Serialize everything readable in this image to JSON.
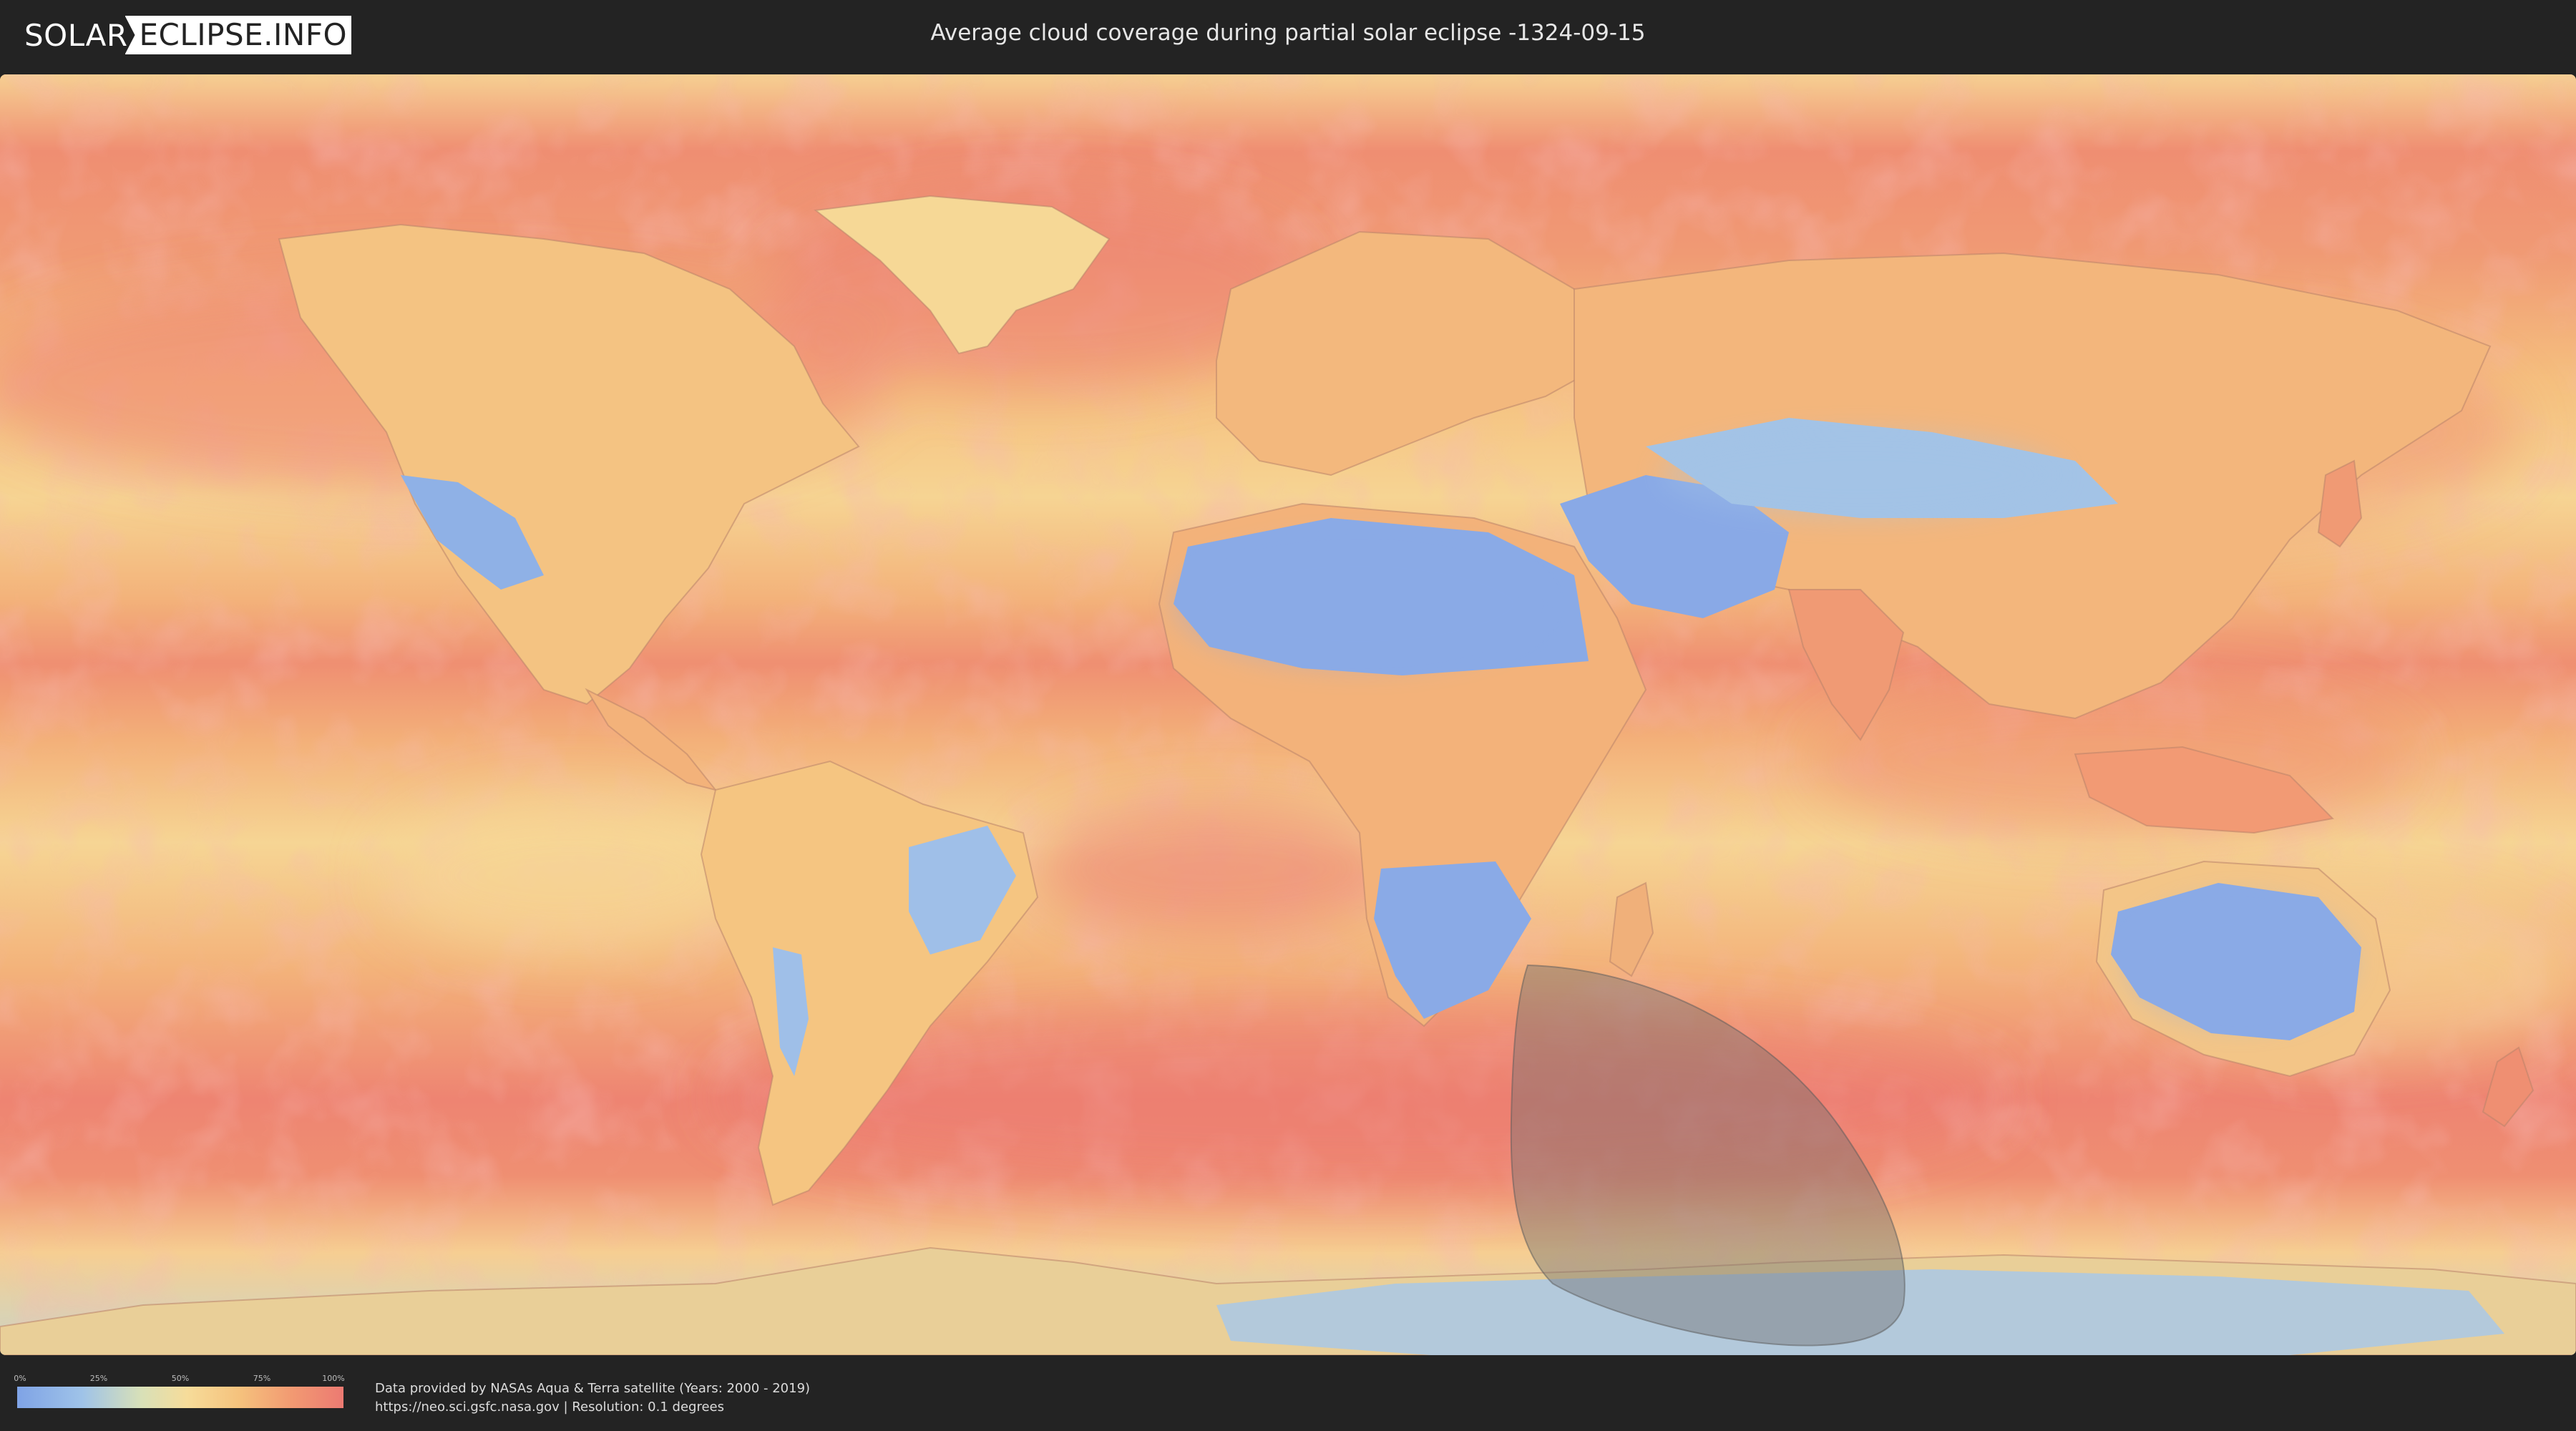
{
  "header": {
    "logo_left": "SOLAR",
    "logo_right": "ECLIPSE.INFO",
    "title": "Average cloud coverage during partial solar eclipse -1324-09-15"
  },
  "legend": {
    "ticks": [
      "0%",
      "25%",
      "50%",
      "75%",
      "100%"
    ],
    "tick_values": [
      0,
      25,
      50,
      75,
      100
    ],
    "colors": [
      "#7fa3e6",
      "#9fc3e8",
      "#f6dc9a",
      "#f5c27d",
      "#ec7a72"
    ]
  },
  "footer": {
    "credit_line_1": "Data provided by NASAs Aqua & Terra satellite (Years: 2000 - 2019)",
    "credit_line_2": "https://neo.sci.gsfc.nasa.gov | Resolution: 0.1 degrees"
  },
  "map": {
    "projection": "equirectangular",
    "eclipse_region": "Southern Indian Ocean towards Antarctica",
    "colors": {
      "cloudy": "#ec7a72",
      "medium": "#f5c27d",
      "light": "#f6dc9a",
      "clear": "#7fa3e6",
      "shadow": "#6e6e6e"
    }
  }
}
